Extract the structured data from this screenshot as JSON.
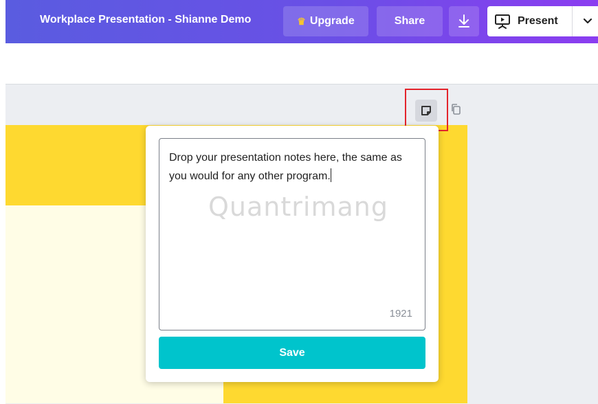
{
  "header": {
    "title": "Workplace Presentation - Shianne Demo",
    "upgrade_label": "Upgrade",
    "share_label": "Share",
    "present_label": "Present"
  },
  "notes_popup": {
    "text": "Drop your presentation notes here, the same as you would for any other program.",
    "char_counter": "1921",
    "save_label": "Save"
  },
  "watermark": "Quantrimang",
  "colors": {
    "header_gradient_start": "#5a5ce0",
    "header_gradient_end": "#8b3df0",
    "save_button": "#00c4cc",
    "slide_yellow": "#fed930",
    "slide_cream": "#fffde6",
    "highlight": "#e3232b"
  },
  "icons": [
    "crown-icon",
    "download-icon",
    "present-icon",
    "chevron-down-icon",
    "notes-icon",
    "duplicate-icon"
  ]
}
